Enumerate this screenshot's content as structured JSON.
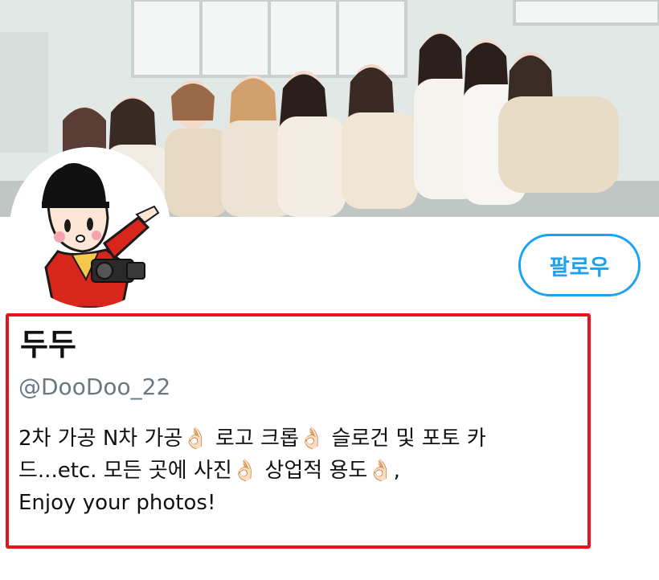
{
  "banner": {
    "image_description_icon": "group-photo-banner"
  },
  "avatar": {
    "icon": "cartoon-photographer-avatar"
  },
  "actions": {
    "follow_label": "팔로우"
  },
  "profile": {
    "display_name": "두두",
    "handle": "@DooDoo_22",
    "bio_lines": [
      "2차 가공 N차 가공👌🏻 로고 크롭👌🏻 슬로건 및 포토 카",
      "드...etc. 모든  곳에 사진👌🏻 상업적 용도👌🏻,",
      "Enjoy your photos!"
    ]
  },
  "colors": {
    "accent": "#1da1f2",
    "highlight_border": "#e8141d",
    "handle_text": "#697882",
    "primary_text": "#111111"
  }
}
